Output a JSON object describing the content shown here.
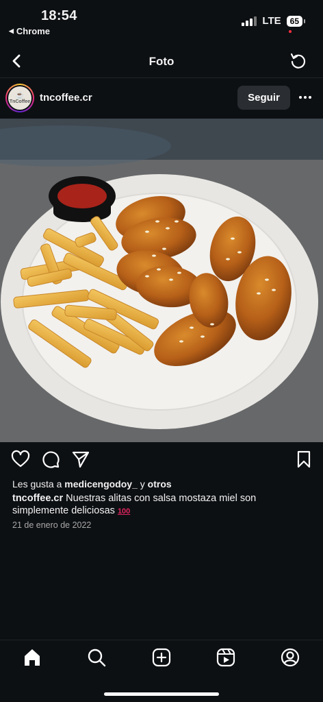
{
  "status_bar": {
    "time": "18:54",
    "back_app": "Chrome",
    "network": "LTE",
    "battery": "65"
  },
  "header": {
    "title": "Foto"
  },
  "post": {
    "username": "tncoffee.cr",
    "avatar_text": "TnCoffee",
    "follow_label": "Seguir",
    "likes_prefix": "Les gusta a",
    "likes_user": "medicengodoy_",
    "likes_suffix": "y",
    "likes_others": "otros",
    "caption_user": "tncoffee.cr",
    "caption_text": "Nuestras alitas con salsa mostaza miel son simplemente deliciosas",
    "caption_emoji": "100",
    "date": "21 de enero de 2022"
  },
  "icons": {
    "back": "chevron-left-icon",
    "refresh": "refresh-icon",
    "like": "heart-icon",
    "comment": "comment-icon",
    "share": "send-icon",
    "save": "bookmark-icon",
    "more": "more-icon"
  },
  "tabbar": [
    "home",
    "search",
    "create",
    "reels",
    "profile"
  ],
  "colors": {
    "background": "#0d1013",
    "follow_button": "#2a2d31",
    "date_text": "#a8a8a8",
    "notification_dot": "#ff3040"
  }
}
